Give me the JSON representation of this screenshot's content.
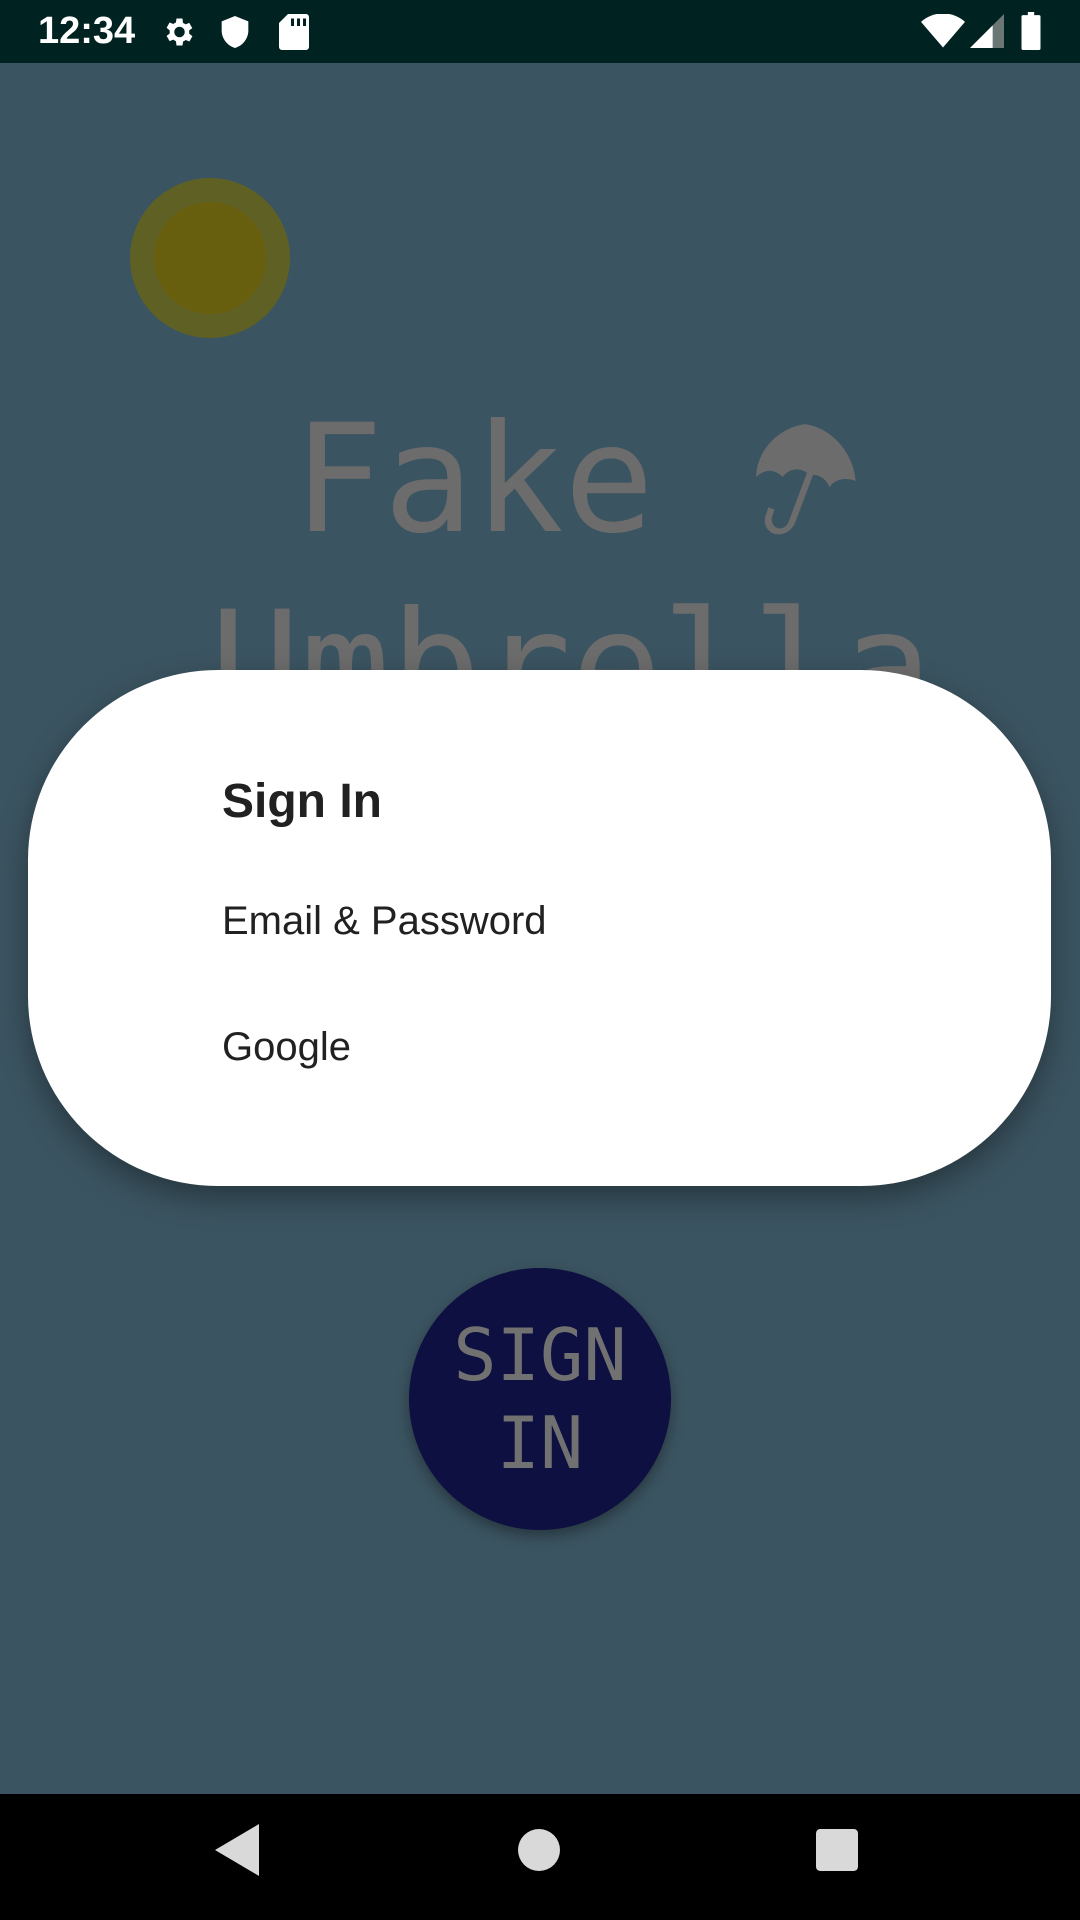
{
  "status_bar": {
    "time": "12:34",
    "left_icons": [
      "gear-icon",
      "shield-icon",
      "sd-card-icon"
    ],
    "right_icons": [
      "wifi-icon",
      "signal-icon",
      "battery-icon"
    ]
  },
  "app": {
    "title_line1": "Fake",
    "title_line2": "Umbrella",
    "sign_in_line1": "SIGN",
    "sign_in_line2": "IN"
  },
  "dialog": {
    "title": "Sign In",
    "options": [
      {
        "label": "Email & Password"
      },
      {
        "label": "Google"
      }
    ]
  },
  "nav": {
    "buttons": [
      "back-icon",
      "home-icon",
      "recents-icon"
    ]
  },
  "colors": {
    "background": "#3b5461",
    "status_bar": "#002220",
    "sun": "#685f0e",
    "fab": "#0d1040",
    "dialog": "#ffffff"
  }
}
